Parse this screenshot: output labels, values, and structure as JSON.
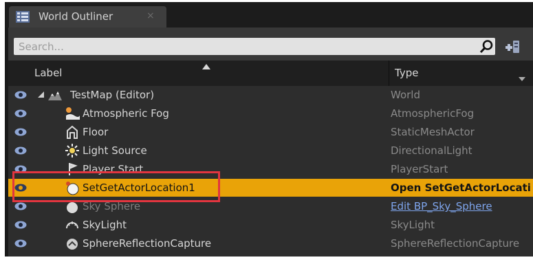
{
  "panel": {
    "tab_title": "World Outliner",
    "tab_close": "×",
    "search": {
      "placeholder": "Search..."
    },
    "columns": {
      "label": "Label",
      "type": "Type"
    }
  },
  "rows": [
    {
      "label": "TestMap (Editor)",
      "type": "World",
      "icon": "world-icon"
    },
    {
      "label": "Atmospheric Fog",
      "type": "AtmosphericFog",
      "icon": "atmospheric-fog-icon"
    },
    {
      "label": "Floor",
      "type": "StaticMeshActor",
      "icon": "static-mesh-icon"
    },
    {
      "label": "Light Source",
      "type": "DirectionalLight",
      "icon": "directional-light-icon"
    },
    {
      "label": "Player Start",
      "type": "PlayerStart",
      "icon": "player-start-icon"
    },
    {
      "label": "SetGetActorLocation1",
      "type": "Open SetGetActorLocati",
      "icon": "blueprint-actor-icon",
      "selected": true
    },
    {
      "label": "Sky Sphere",
      "type": "Edit BP_Sky_Sphere",
      "icon": "sky-sphere-icon"
    },
    {
      "label": "SkyLight",
      "type": "SkyLight",
      "icon": "sky-light-icon"
    },
    {
      "label": "SphereReflectionCapture",
      "type": "SphereReflectionCapture",
      "icon": "reflection-capture-icon"
    }
  ],
  "colors": {
    "selection": "#e9a308",
    "highlight_box": "#e2353f",
    "link": "#7fa6ee",
    "panel_bg": "#2d2d2d"
  }
}
